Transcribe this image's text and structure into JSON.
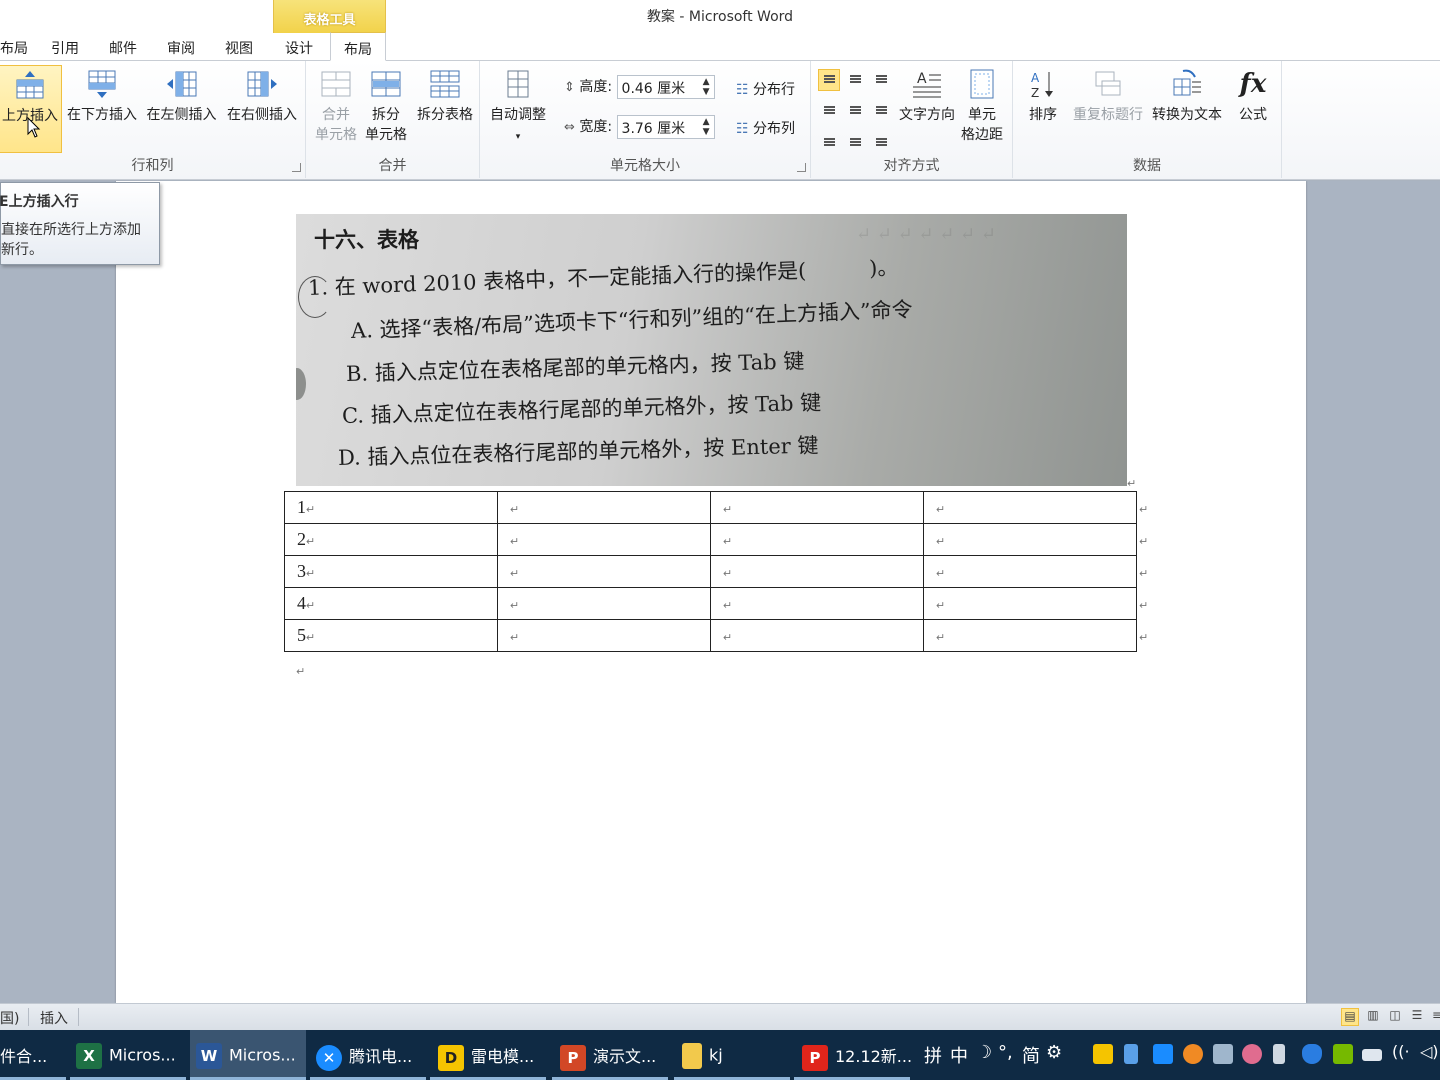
{
  "window": {
    "title": "教案 - Microsoft Word",
    "context_tab_header": "表格工具"
  },
  "tabs": [
    {
      "label": "布局"
    },
    {
      "label": "引用"
    },
    {
      "label": "邮件"
    },
    {
      "label": "审阅"
    },
    {
      "label": "视图"
    },
    {
      "label": "设计"
    },
    {
      "label": "布局"
    }
  ],
  "ribbon": {
    "rows_cols": {
      "label": "行和列",
      "insert_above": "上方插入",
      "insert_below": "在下方插入",
      "insert_left": "在左侧插入",
      "insert_right": "在右侧插入"
    },
    "merge": {
      "label": "合并",
      "merge_cells_1": "合并",
      "merge_cells_2": "单元格",
      "split_cells_1": "拆分",
      "split_cells_2": "单元格",
      "split_table": "拆分表格"
    },
    "cell_size": {
      "label": "单元格大小",
      "autofit": "自动调整",
      "height_label": "高度:",
      "height_value": "0.46 厘米",
      "width_label": "宽度:",
      "width_value": "3.76 厘米",
      "distribute_rows": "分布行",
      "distribute_cols": "分布列"
    },
    "alignment": {
      "label": "对齐方式",
      "text_direction": "文字方向",
      "cell_margins_1": "单元",
      "cell_margins_2": "格边距"
    },
    "data": {
      "label": "数据",
      "sort": "排序",
      "repeat_header": "重复标题行",
      "convert_to_text": "转换为文本",
      "formula": "公式"
    }
  },
  "tooltip": {
    "title": "E上方插入行",
    "description": "直接在所选行上方添加新行。"
  },
  "document": {
    "photo_text": {
      "heading": "十六、表格",
      "question": "1. 在 word 2010 表格中，不一定能插入行的操作是(　　　)。",
      "option_a": "A. 选择“表格/布局”选项卡下“行和列”组的“在上方插入”命令",
      "option_b": "B. 插入点定位在表格尾部的单元格内，按 Tab 键",
      "option_c": "C. 插入点定位在表格行尾部的单元格外，按 Tab 键",
      "option_d": "D. 插入点位在表格行尾部的单元格外，按 Enter 键"
    },
    "table_rows": [
      [
        "1",
        "",
        "",
        ""
      ],
      [
        "2",
        "",
        "",
        ""
      ],
      [
        "3",
        "",
        "",
        ""
      ],
      [
        "4",
        "",
        "",
        ""
      ],
      [
        "5",
        "",
        "",
        ""
      ]
    ],
    "paragraph_mark": "↵"
  },
  "statusbar": {
    "language": "国)",
    "mode": "插入"
  },
  "taskbar": {
    "items": [
      {
        "label": "件合...",
        "icon": "app-icon"
      },
      {
        "label": "Micros...",
        "icon": "excel-icon"
      },
      {
        "label": "Micros...",
        "icon": "word-icon",
        "active": true
      },
      {
        "label": "腾讯电...",
        "icon": "tencent-icon"
      },
      {
        "label": "雷电模...",
        "icon": "ldplayer-icon"
      },
      {
        "label": "演示文...",
        "icon": "powerpoint-icon"
      },
      {
        "label": "kj",
        "icon": "folder-icon"
      },
      {
        "label": "12.12新...",
        "icon": "pdf-icon"
      }
    ],
    "ime": [
      "拼",
      "中",
      "☽",
      "°,",
      "简",
      "⚙"
    ]
  },
  "colors": {
    "context_tab": "#f2d24a",
    "taskbar": "#0f2a44",
    "selected": "#ffe58a"
  }
}
